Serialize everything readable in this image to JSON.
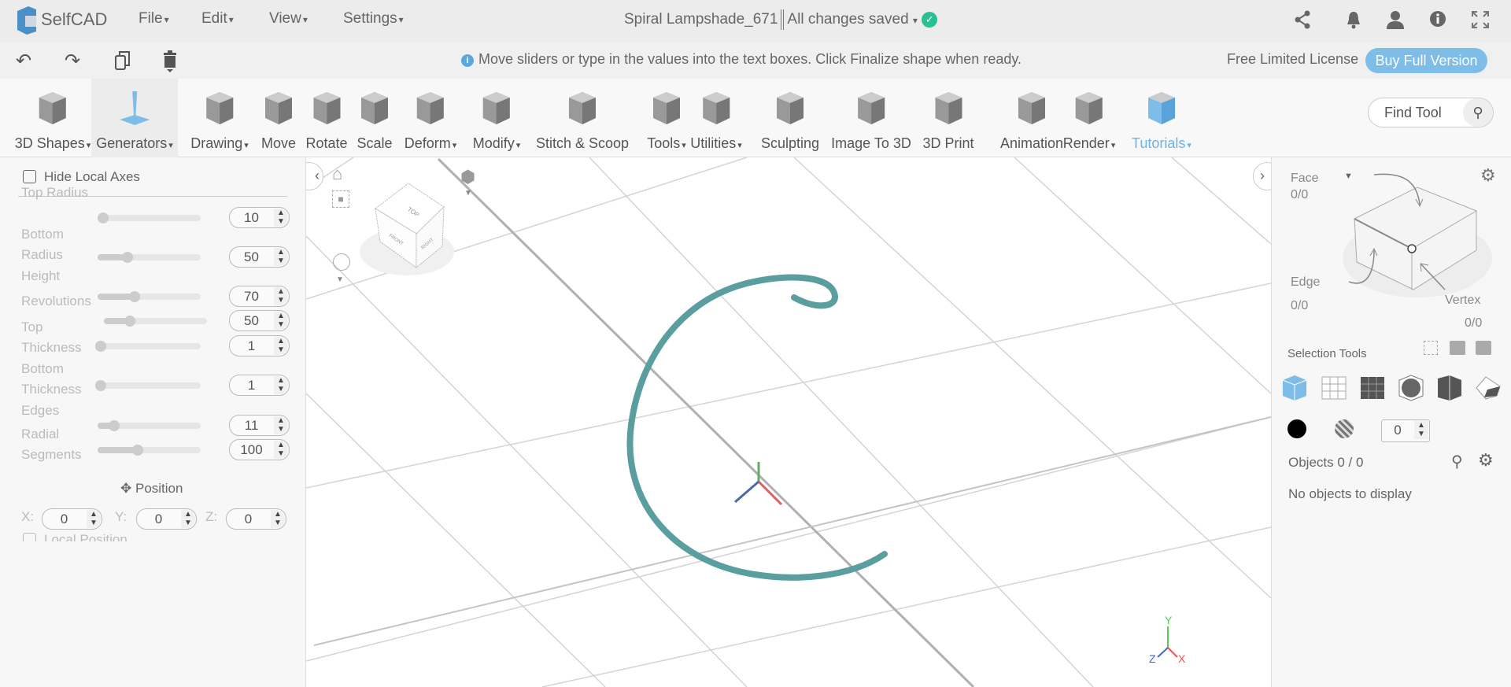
{
  "app": {
    "name": "SelfCAD",
    "project_title": "Spiral Lampshade_671",
    "save_status": "All changes saved"
  },
  "menus": [
    "File",
    "Edit",
    "View",
    "Settings"
  ],
  "top_icons": [
    "share-icon",
    "bell-icon",
    "user-icon",
    "info-icon",
    "fullscreen-icon"
  ],
  "bar2": {
    "info_message": "Move sliders or type in the values into the text boxes. Click Finalize shape when ready.",
    "license": "Free Limited License",
    "buy_button": "Buy Full Version"
  },
  "toolbar": {
    "items": [
      {
        "label": "3D Shapes",
        "dropdown": true
      },
      {
        "label": "Generators",
        "dropdown": true,
        "active": true
      },
      {
        "label": "Drawing",
        "dropdown": true
      },
      {
        "label": "Move"
      },
      {
        "label": "Rotate"
      },
      {
        "label": "Scale"
      },
      {
        "label": "Deform",
        "dropdown": true
      },
      {
        "label": "Modify",
        "dropdown": true
      },
      {
        "label": "Stitch & Scoop"
      },
      {
        "label": "Tools",
        "dropdown": true
      },
      {
        "label": "Utilities",
        "dropdown": true
      },
      {
        "label": "Sculpting"
      },
      {
        "label": "Image To 3D"
      },
      {
        "label": "3D Print"
      },
      {
        "label": "Animation"
      },
      {
        "label": "Render",
        "dropdown": true
      },
      {
        "label": "Tutorials",
        "dropdown": true,
        "blue": true
      }
    ],
    "find_tool_placeholder": "Find Tool"
  },
  "left_panel": {
    "hide_local_axes": "Hide Local Axes",
    "params": [
      {
        "label": "Top Radius",
        "value": "10",
        "fraction": 0.05
      },
      {
        "label": "Bottom Radius",
        "value": "50",
        "fraction": 0.29
      },
      {
        "label": "Height",
        "value": "70",
        "fraction": 0.36
      },
      {
        "label": "Revolutions",
        "value": "50",
        "fraction": 0.25
      },
      {
        "label": "Top Thickness",
        "value": "1",
        "fraction": 0.0
      },
      {
        "label": "Bottom Thickness",
        "value": "1",
        "fraction": 0.0
      },
      {
        "label": "Edges",
        "value": "11",
        "fraction": 0.16
      },
      {
        "label": "Radial Segments",
        "value": "100",
        "fraction": 0.39
      }
    ],
    "position_label": "Position",
    "x_label": "X:",
    "y_label": "Y:",
    "z_label": "Z:",
    "x": "0",
    "y": "0",
    "z": "0",
    "local_position": "Local Position"
  },
  "viewport": {
    "cube_top": "TOP",
    "cube_front": "FRONT",
    "cube_right": "RIGHT",
    "axis_x": "X",
    "axis_y": "Y",
    "axis_z": "Z",
    "spiral_color": "#5a9ea0"
  },
  "right_panel": {
    "face_label": "Face",
    "face_count": "0/0",
    "edge_label": "Edge",
    "edge_count": "0/0",
    "vertex_label": "Vertex",
    "vertex_count": "0/0",
    "selection_tools": "Selection Tools",
    "stepper_value": "0",
    "objects": "Objects 0 / 0",
    "no_objects": "No objects to display"
  }
}
